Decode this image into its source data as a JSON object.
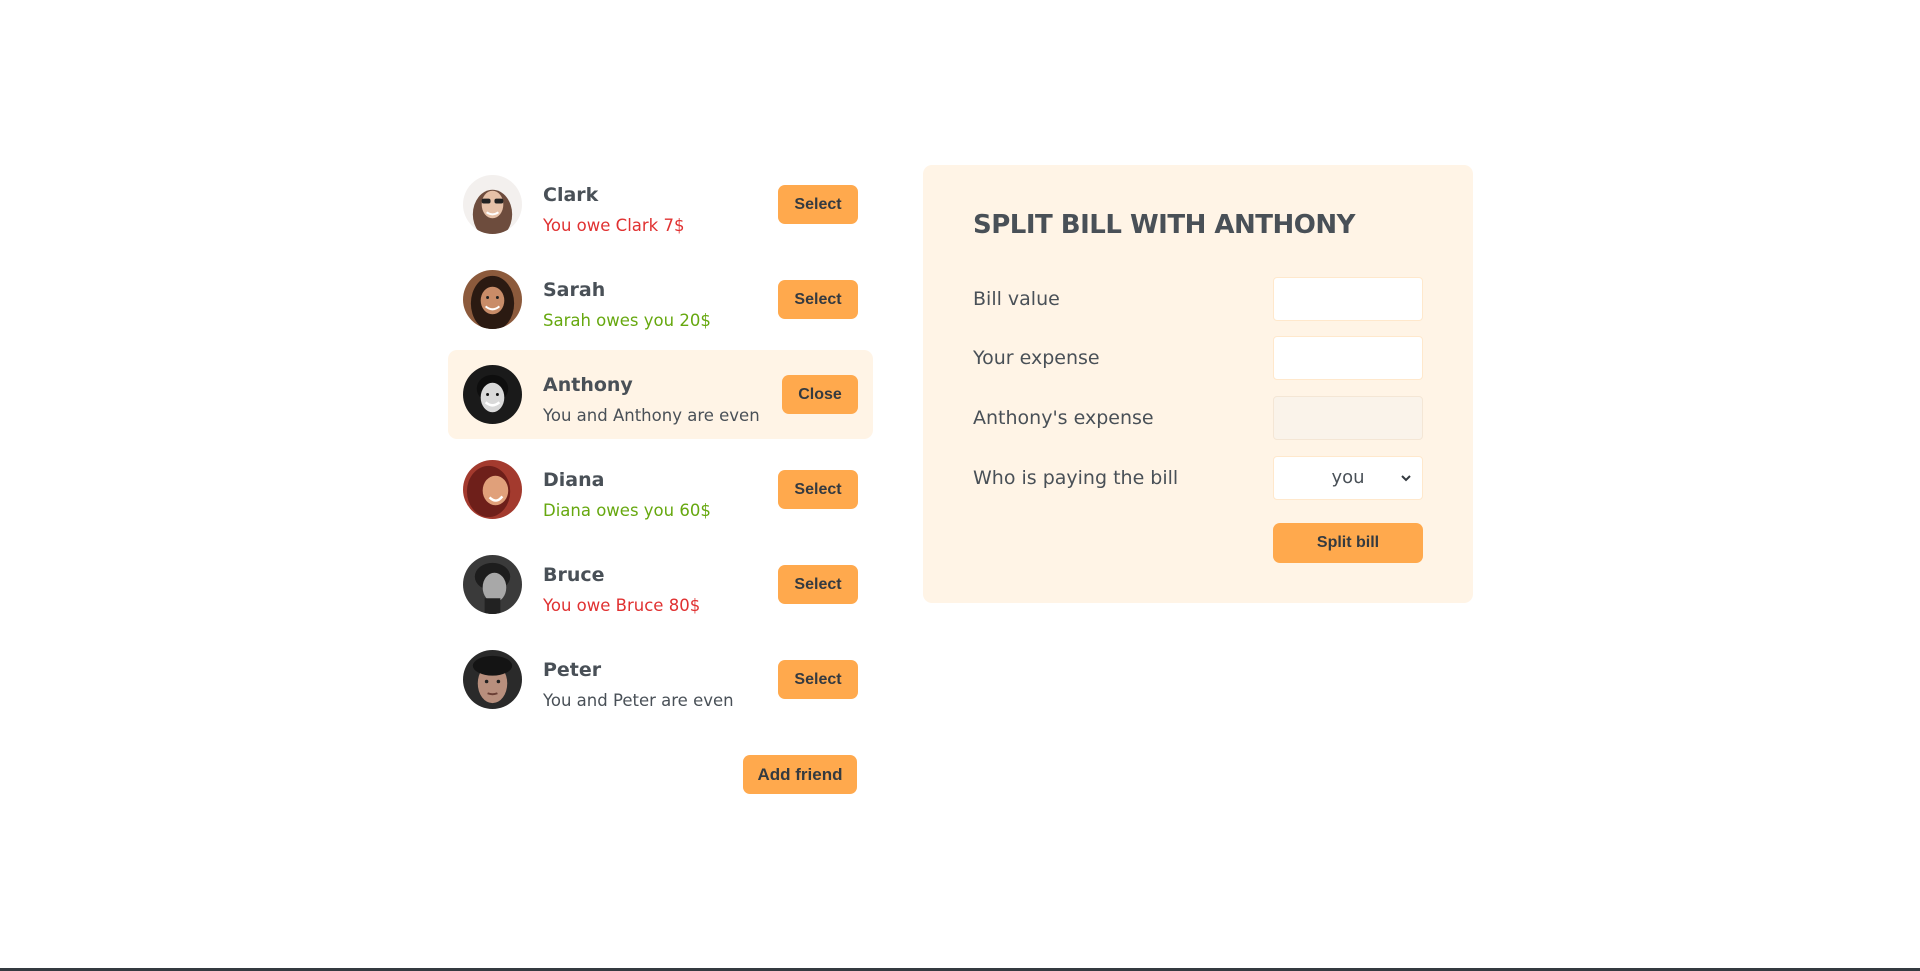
{
  "friends": [
    {
      "name": "Clark",
      "status": "You owe Clark 7$",
      "status_type": "owe",
      "button": "Select",
      "selected": false
    },
    {
      "name": "Sarah",
      "status": "Sarah owes you 20$",
      "status_type": "owed",
      "button": "Select",
      "selected": false
    },
    {
      "name": "Anthony",
      "status": "You and Anthony are even",
      "status_type": "even",
      "button": "Close",
      "selected": true
    },
    {
      "name": "Diana",
      "status": "Diana owes you 60$",
      "status_type": "owed",
      "button": "Select",
      "selected": false
    },
    {
      "name": "Bruce",
      "status": "You owe Bruce 80$",
      "status_type": "owe",
      "button": "Select",
      "selected": false
    },
    {
      "name": "Peter",
      "status": "You and Peter are even",
      "status_type": "even",
      "button": "Select",
      "selected": false
    }
  ],
  "add_friend_label": "Add friend",
  "form": {
    "title": "SPLIT BILL WITH ANTHONY",
    "bill_value_label": "Bill value",
    "bill_value": "",
    "your_expense_label": "Your expense",
    "your_expense": "",
    "friend_expense_label": "Anthony's expense",
    "friend_expense": "",
    "payer_label": "Who is paying the bill",
    "payer_value": "you",
    "split_label": "Split bill"
  },
  "colors": {
    "accent": "#ffa94d",
    "highlight_bg": "#fff4e6",
    "owe": "#e03131",
    "owed": "#66a80f",
    "text": "#495057"
  },
  "icons": {
    "payer_select": "chevron-down-icon"
  }
}
